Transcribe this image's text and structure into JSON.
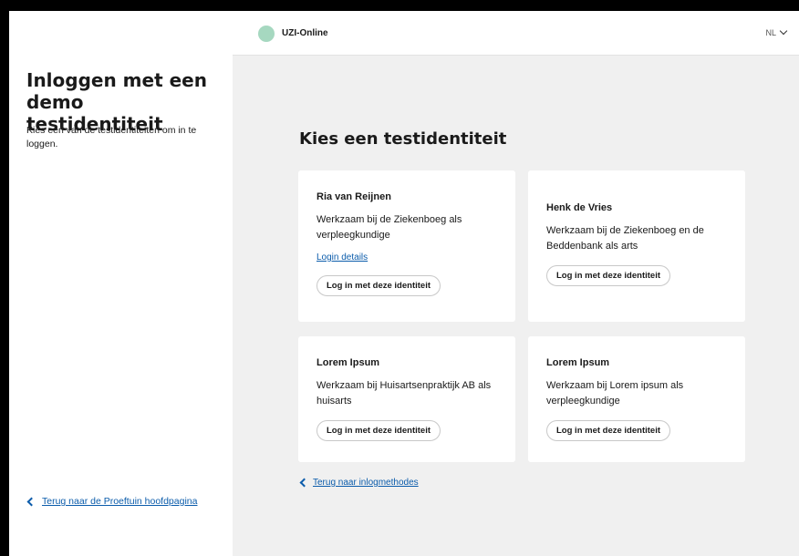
{
  "sidebar": {
    "title": "Inloggen met een demo testidentiteit",
    "description": "Kies een van de testidentiteiten om in te loggen.",
    "back_link": "Terug naar de Proeftuin hoofdpagina"
  },
  "header": {
    "app_name": "UZI-Online",
    "language": "NL"
  },
  "main": {
    "title": "Kies een testidentiteit",
    "cards": [
      {
        "name": "Ria van Reijnen",
        "description": "Werkzaam bij de Ziekenboeg als verpleegkundige",
        "details_link": "Login details",
        "button": "Log in met deze identiteit"
      },
      {
        "name": "Henk de Vries",
        "description": "Werkzaam bij de Ziekenboeg en de Beddenbank als arts",
        "button": "Log in met deze identiteit"
      },
      {
        "name": "Lorem Ipsum",
        "description": "Werkzaam bij Huisartsenpraktijk AB als huisarts",
        "button": "Log in met deze identiteit"
      },
      {
        "name": "Lorem Ipsum",
        "description": "Werkzaam bij Lorem ipsum als verpleegkundige",
        "button": "Log in met deze identiteit"
      }
    ],
    "back_link": "Terug naar inlogmethodes"
  },
  "colors": {
    "link": "#0b5cab",
    "logo": "#a6d8c0",
    "background": "#f0f0f0"
  }
}
